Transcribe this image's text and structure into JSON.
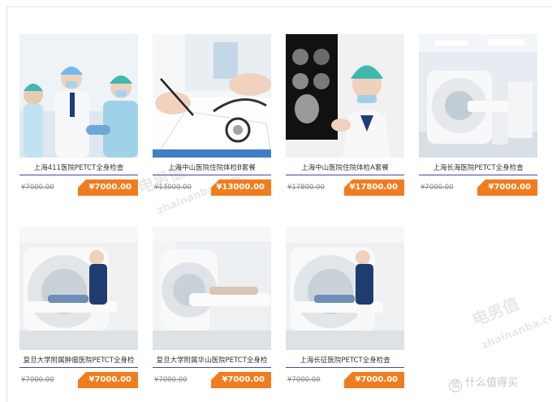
{
  "products": [
    {
      "title": "上海411医院PETCT全身检查",
      "old_price": "¥7000.00",
      "price": "¥7000.00",
      "image": "medical-staff-photo"
    },
    {
      "title": "上海中山医院住院体检B套餐",
      "old_price": "¥13000.00",
      "price": "¥13000.00",
      "image": "doctor-writing-photo"
    },
    {
      "title": "上海中山医院住院体检A套餐",
      "old_price": "¥17800.00",
      "price": "¥17800.00",
      "image": "xray-nurse-photo"
    },
    {
      "title": "上海长海医院PETCT全身检查",
      "old_price": "¥7000.00",
      "price": "¥7000.00",
      "image": "ct-scanner-photo"
    },
    {
      "title": "复旦大学附属肿瘤医院PETCT全身检",
      "old_price": "¥7000.00",
      "price": "¥7000.00",
      "image": "mri-patient-photo"
    },
    {
      "title": "复旦大学附属华山医院PETCT全身检",
      "old_price": "¥7000.00",
      "price": "¥7000.00",
      "image": "mri-room-photo"
    },
    {
      "title": "上海长征医院PETCT全身检查",
      "old_price": "¥7000.00",
      "price": "¥7000.00",
      "image": "mri-patient-photo"
    }
  ],
  "watermark": {
    "cn": "电男值",
    "en": "zhainanba.com"
  },
  "logo": {
    "mark": "值",
    "text": "什么值得买"
  },
  "colors": {
    "badge": "#f07c1e",
    "rule": "#3f4aa6"
  }
}
